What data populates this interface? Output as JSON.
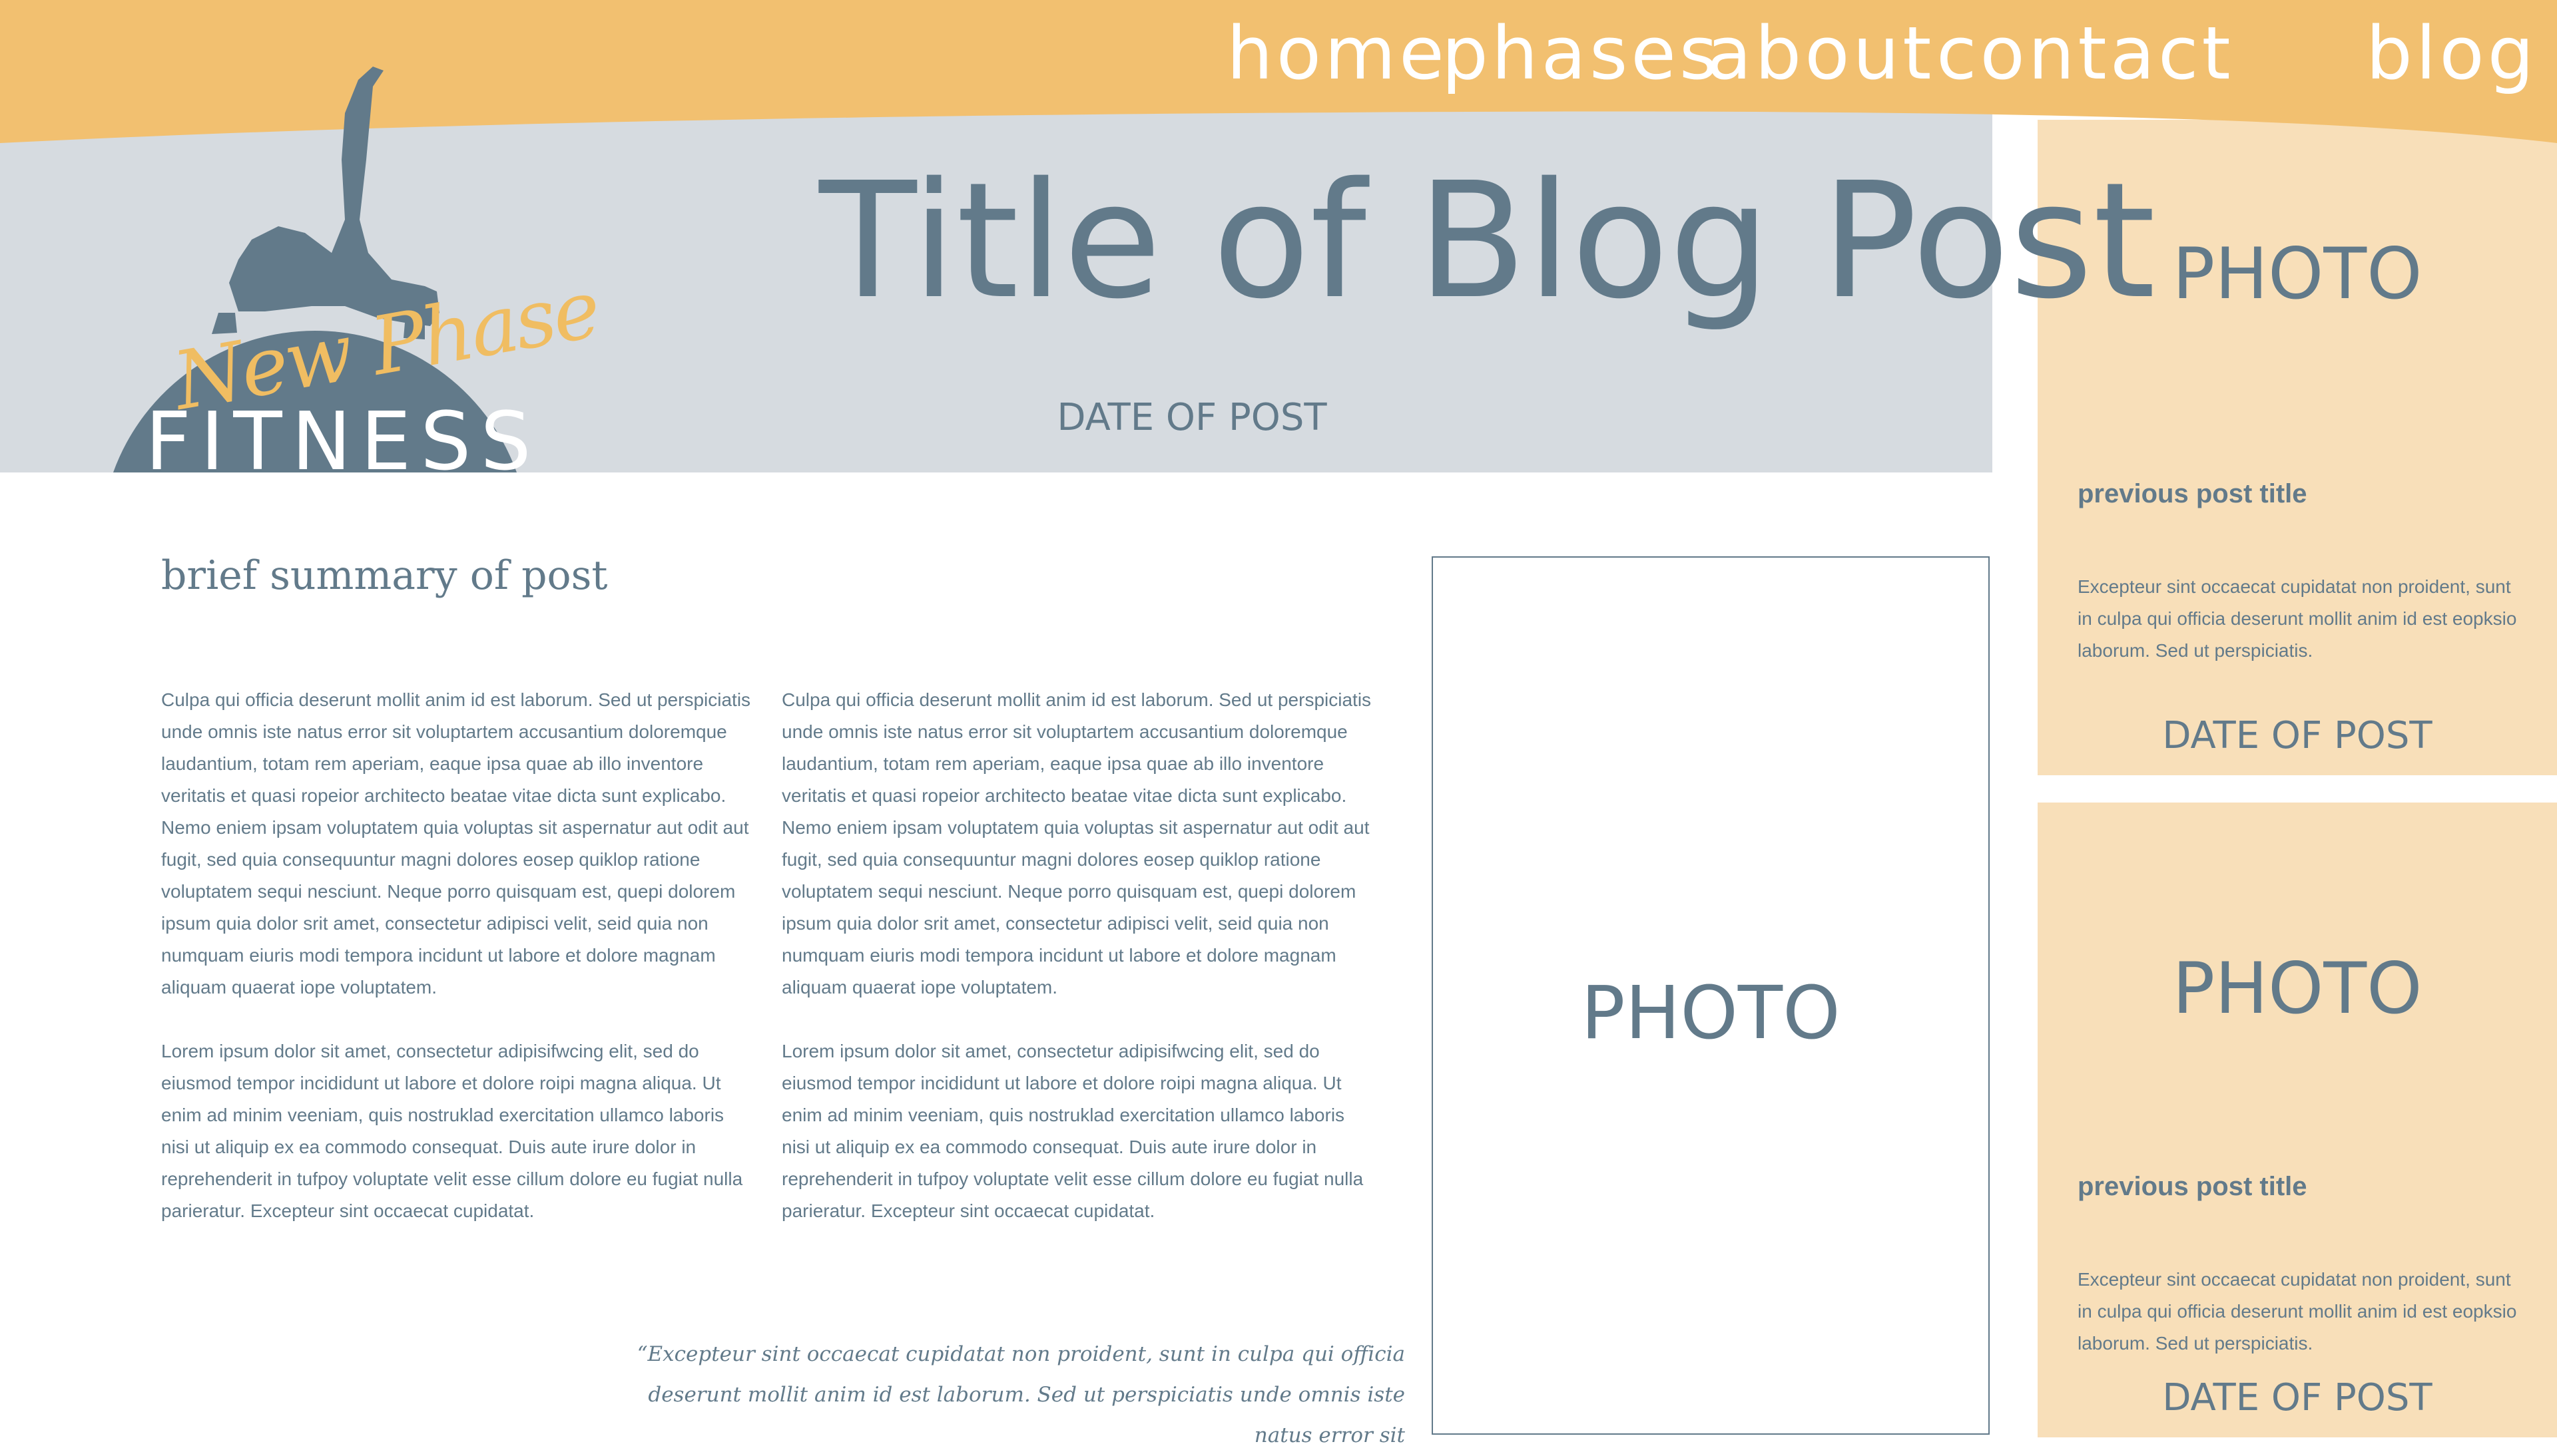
{
  "nav": {
    "home": "home",
    "phases": "phases",
    "about": "about",
    "contact": "contact",
    "blog": "blog"
  },
  "logo": {
    "script_text": "New Phase",
    "word_text": "FITNESS"
  },
  "hero": {
    "title": "Title of Blog Post",
    "date": "DATE OF POST"
  },
  "post": {
    "summary": "brief summary of post",
    "columns": [
      {
        "paragraphs": [
          "Culpa qui officia deserunt mollit anim id est laborum. Sed ut perspiciatis unde omnis iste natus error sit voluptartem accusantium doloremque laudantium, totam rem aperiam, eaque ipsa quae ab illo inventore veritatis et quasi ropeior architecto beatae vitae dicta sunt explicabo. Nemo eniem ipsam voluptatem quia voluptas sit aspernatur aut odit aut fugit, sed quia consequuntur magni dolores eosep quiklop ratione voluptatem sequi nesciunt. Neque porro quisquam est, quepi dolorem ipsum quia dolor srit amet, consectetur adipisci velit, seid quia non numquam eiuris modi tempora incidunt ut labore et dolore magnam aliquam quaerat iope voluptatem.",
          "Lorem ipsum dolor sit amet, consectetur adipisifwcing elit, sed do eiusmod tempor incididunt ut labore et dolore roipi magna aliqua. Ut enim ad minim veeniam, quis nostruklad exercitation ullamco laboris nisi ut aliquip ex ea commodo consequat. Duis aute irure dolor in reprehenderit in tufpoy voluptate velit esse cillum dolore eu fugiat nulla parieratur. Excepteur sint occaecat cupidatat."
        ]
      },
      {
        "paragraphs": [
          "Culpa qui officia deserunt mollit anim id est laborum. Sed ut perspiciatis unde omnis iste natus error sit voluptartem accusantium doloremque laudantium, totam rem aperiam, eaque ipsa quae ab illo inventore veritatis et quasi ropeior architecto beatae vitae dicta sunt explicabo. Nemo eniem ipsam voluptatem quia voluptas sit aspernatur aut odit aut fugit, sed quia consequuntur magni dolores eosep quiklop ratione voluptatem sequi nesciunt. Neque porro quisquam est, quepi dolorem ipsum quia dolor srit amet, consectetur adipisci velit, seid quia non numquam eiuris modi tempora incidunt ut labore et dolore magnam aliquam quaerat iope voluptatem.",
          "Lorem ipsum dolor sit amet, consectetur adipisifwcing elit, sed do eiusmod tempor incididunt ut labore et dolore roipi magna aliqua. Ut enim ad minim veeniam, quis nostruklad exercitation ullamco laboris nisi ut aliquip ex ea commodo consequat. Duis aute irure dolor in reprehenderit in tufpoy voluptate velit esse cillum dolore eu fugiat nulla parieratur. Excepteur sint occaecat cupidatat."
        ]
      }
    ],
    "pull_quote": "“Excepteur sint occaecat cupidatat non proident, sunt in culpa qui officia deserunt mollit anim id est laborum. Sed ut perspiciatis unde omnis iste natus error sit",
    "photo_label": "PHOTO"
  },
  "sidebar": {
    "cards": [
      {
        "photo_label": "PHOTO",
        "title": "previous post title",
        "excerpt": "Excepteur sint occaecat cupidatat non proident, sunt in culpa qui officia deserunt mollit anim id est eopksio laborum. Sed ut perspiciatis.",
        "date": "DATE OF POST"
      },
      {
        "photo_label": "PHOTO",
        "title": "previous post title",
        "excerpt": "Excepteur sint occaecat cupidatat non proident, sunt in culpa qui officia deserunt mollit anim id est eopksio laborum. Sed ut perspiciatis.",
        "date": "DATE OF POST"
      }
    ]
  },
  "colors": {
    "banner_orange": "#f2c070",
    "slate": "#627a8a",
    "hero_gray": "#d6dbe0",
    "card_peach": "#f8dfb9"
  }
}
